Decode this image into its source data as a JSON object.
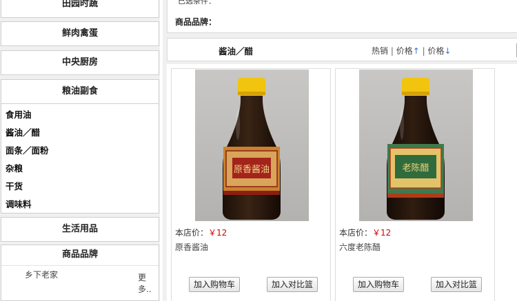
{
  "sidebar": {
    "categories": {
      "tianyuan": "田园时蔬",
      "xianrou": "鲜肉禽蛋",
      "zhongyang": "中央厨房",
      "liangyou": "粮油副食",
      "shenghuo": "生活用品"
    },
    "subcategories": [
      "食用油",
      "酱油／醋",
      "面条／面粉",
      "杂粮",
      "干货",
      "调味料"
    ],
    "brand_box": {
      "title": "商品品牌",
      "item": "乡下老家",
      "more": "更多.."
    }
  },
  "filter": {
    "cut_label": "已选条件：",
    "brand_label": "商品品牌："
  },
  "sortbar": {
    "title": "酱油／醋",
    "hot": "热销",
    "separator": "|",
    "price_up": "价格↑",
    "price_down": "价格↓"
  },
  "products": [
    {
      "price_label": "本店价：",
      "price": "￥12",
      "name": "原香酱油",
      "add_cart": "加入购物车",
      "add_compare": "加入对比篮",
      "label_text": "原香酱油",
      "label_bg": "#c9822e"
    },
    {
      "price_label": "本店价：",
      "price": "￥12",
      "name": "六度老陈醋",
      "add_cart": "加入购物车",
      "add_compare": "加入对比篮",
      "label_text": "老陈醋",
      "label_bg": "#3f7a4a"
    }
  ],
  "colors": {
    "price_red": "#d40000",
    "arrow_blue": "#3a6fd8"
  }
}
